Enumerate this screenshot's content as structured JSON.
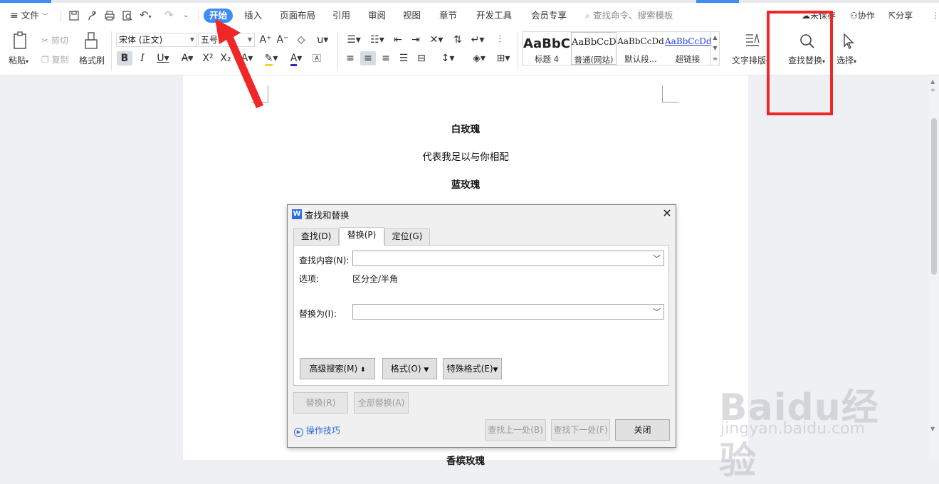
{
  "menubar": {
    "file_label": "文件",
    "tabs": [
      "开始",
      "插入",
      "页面布局",
      "引用",
      "审阅",
      "视图",
      "章节",
      "开发工具",
      "会员专享"
    ],
    "active_tab": "开始",
    "search_placeholder": "查找命令、搜索模板",
    "unsaved_label": "未保存",
    "collab_label": "协作",
    "share_label": "分享"
  },
  "ribbon": {
    "paste_label": "粘贴",
    "cut_label": "剪切",
    "copy_label": "复制",
    "format_painter_label": "格式刷",
    "font_name": "宋体 (正文)",
    "font_size": "五号",
    "styles": [
      {
        "preview": "AaBbC",
        "name": "标题 4"
      },
      {
        "preview": "AaBbCcD",
        "name": "普通(网站)"
      },
      {
        "preview": "AaBbCcDd",
        "name": "默认段..."
      },
      {
        "preview": "AaBbCcDd",
        "name": "超链接"
      }
    ],
    "text_layout_label": "文字排版",
    "find_replace_label": "查找替换",
    "select_label": "选择"
  },
  "document": {
    "lines": [
      "白玫瑰",
      "代表我足以与你相配",
      "蓝玫瑰",
      "香槟玫瑰"
    ]
  },
  "dialog": {
    "title": "查找和替换",
    "tabs": [
      "查找(D)",
      "替换(P)",
      "定位(G)"
    ],
    "active_tab": "替换(P)",
    "find_label": "查找内容(N):",
    "find_value": "",
    "options_label": "选项:",
    "options_value": "区分全/半角",
    "replace_label": "替换为(I):",
    "replace_value": "",
    "advanced_search_label": "高级搜索(M)",
    "format_label": "格式(O)",
    "special_format_label": "特殊格式(E)",
    "replace_button": "替换(R)",
    "replace_all_button": "全部替换(A)",
    "tips_label": "操作技巧",
    "find_prev_button": "查找上一处(B)",
    "find_next_button": "查找下一处(F)",
    "close_button": "关闭"
  },
  "watermark": {
    "brand": "Baidu经验",
    "url": "jingyan.baidu.com"
  },
  "colors": {
    "accent": "#3f8cf4",
    "annotation_red": "#f02727"
  }
}
